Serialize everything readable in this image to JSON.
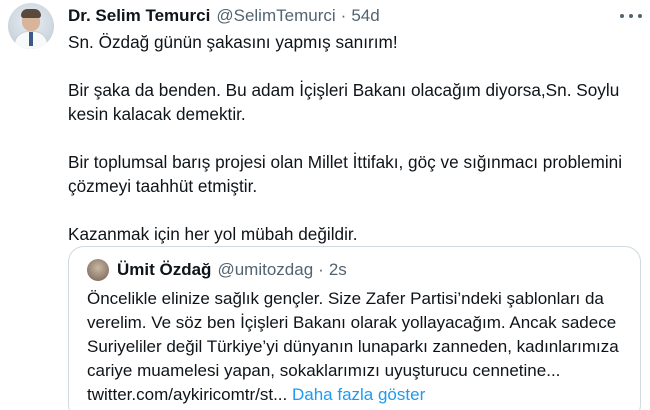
{
  "tweet": {
    "author": {
      "display_name": "Dr. Selim Temurci",
      "handle": "@SelimTemurci",
      "separator": "·",
      "time": "54d"
    },
    "more_icon": "more-horizontal-icon",
    "text_lines": [
      "Sn. Özdağ günün şakasını yapmış sanırım!",
      "",
      "Bir şaka da benden. Bu adam İçişleri Bakanı olacağım diyorsa,Sn. Soylu",
      "kesin kalacak demektir.",
      "",
      "Bir toplumsal barış projesi olan Millet İttifakı, göç ve sığınmacı problemini",
      "çözmeyi taahhüt etmiştir.",
      "",
      "Kazanmak için her yol mübah değildir."
    ]
  },
  "quoted_tweet": {
    "author": {
      "display_name": "Ümit Özdağ",
      "handle": "@umitozdag",
      "separator": "·",
      "time": "2s"
    },
    "text_lines": [
      "Öncelikle elinize sağlık gençler. Size Zafer Partisi’ndeki şablonları da",
      "verelim. Ve söz ben İçişleri Bakanı olarak yollayacağım. Ancak sadece",
      "Suriyeliler değil Türkiye’yi dünyanın lunaparkı zanneden, kadınlarımıza",
      "cariye muamelesi yapan, sokaklarımızı uyuşturucu cennetine..."
    ],
    "link_text": "twitter.com/aykiricomtr/st...",
    "show_more": "Daha fazla göster"
  },
  "colors": {
    "text": "#0f1419",
    "secondary": "#536471",
    "link": "#1d9bf0",
    "border": "#cfd9de"
  }
}
